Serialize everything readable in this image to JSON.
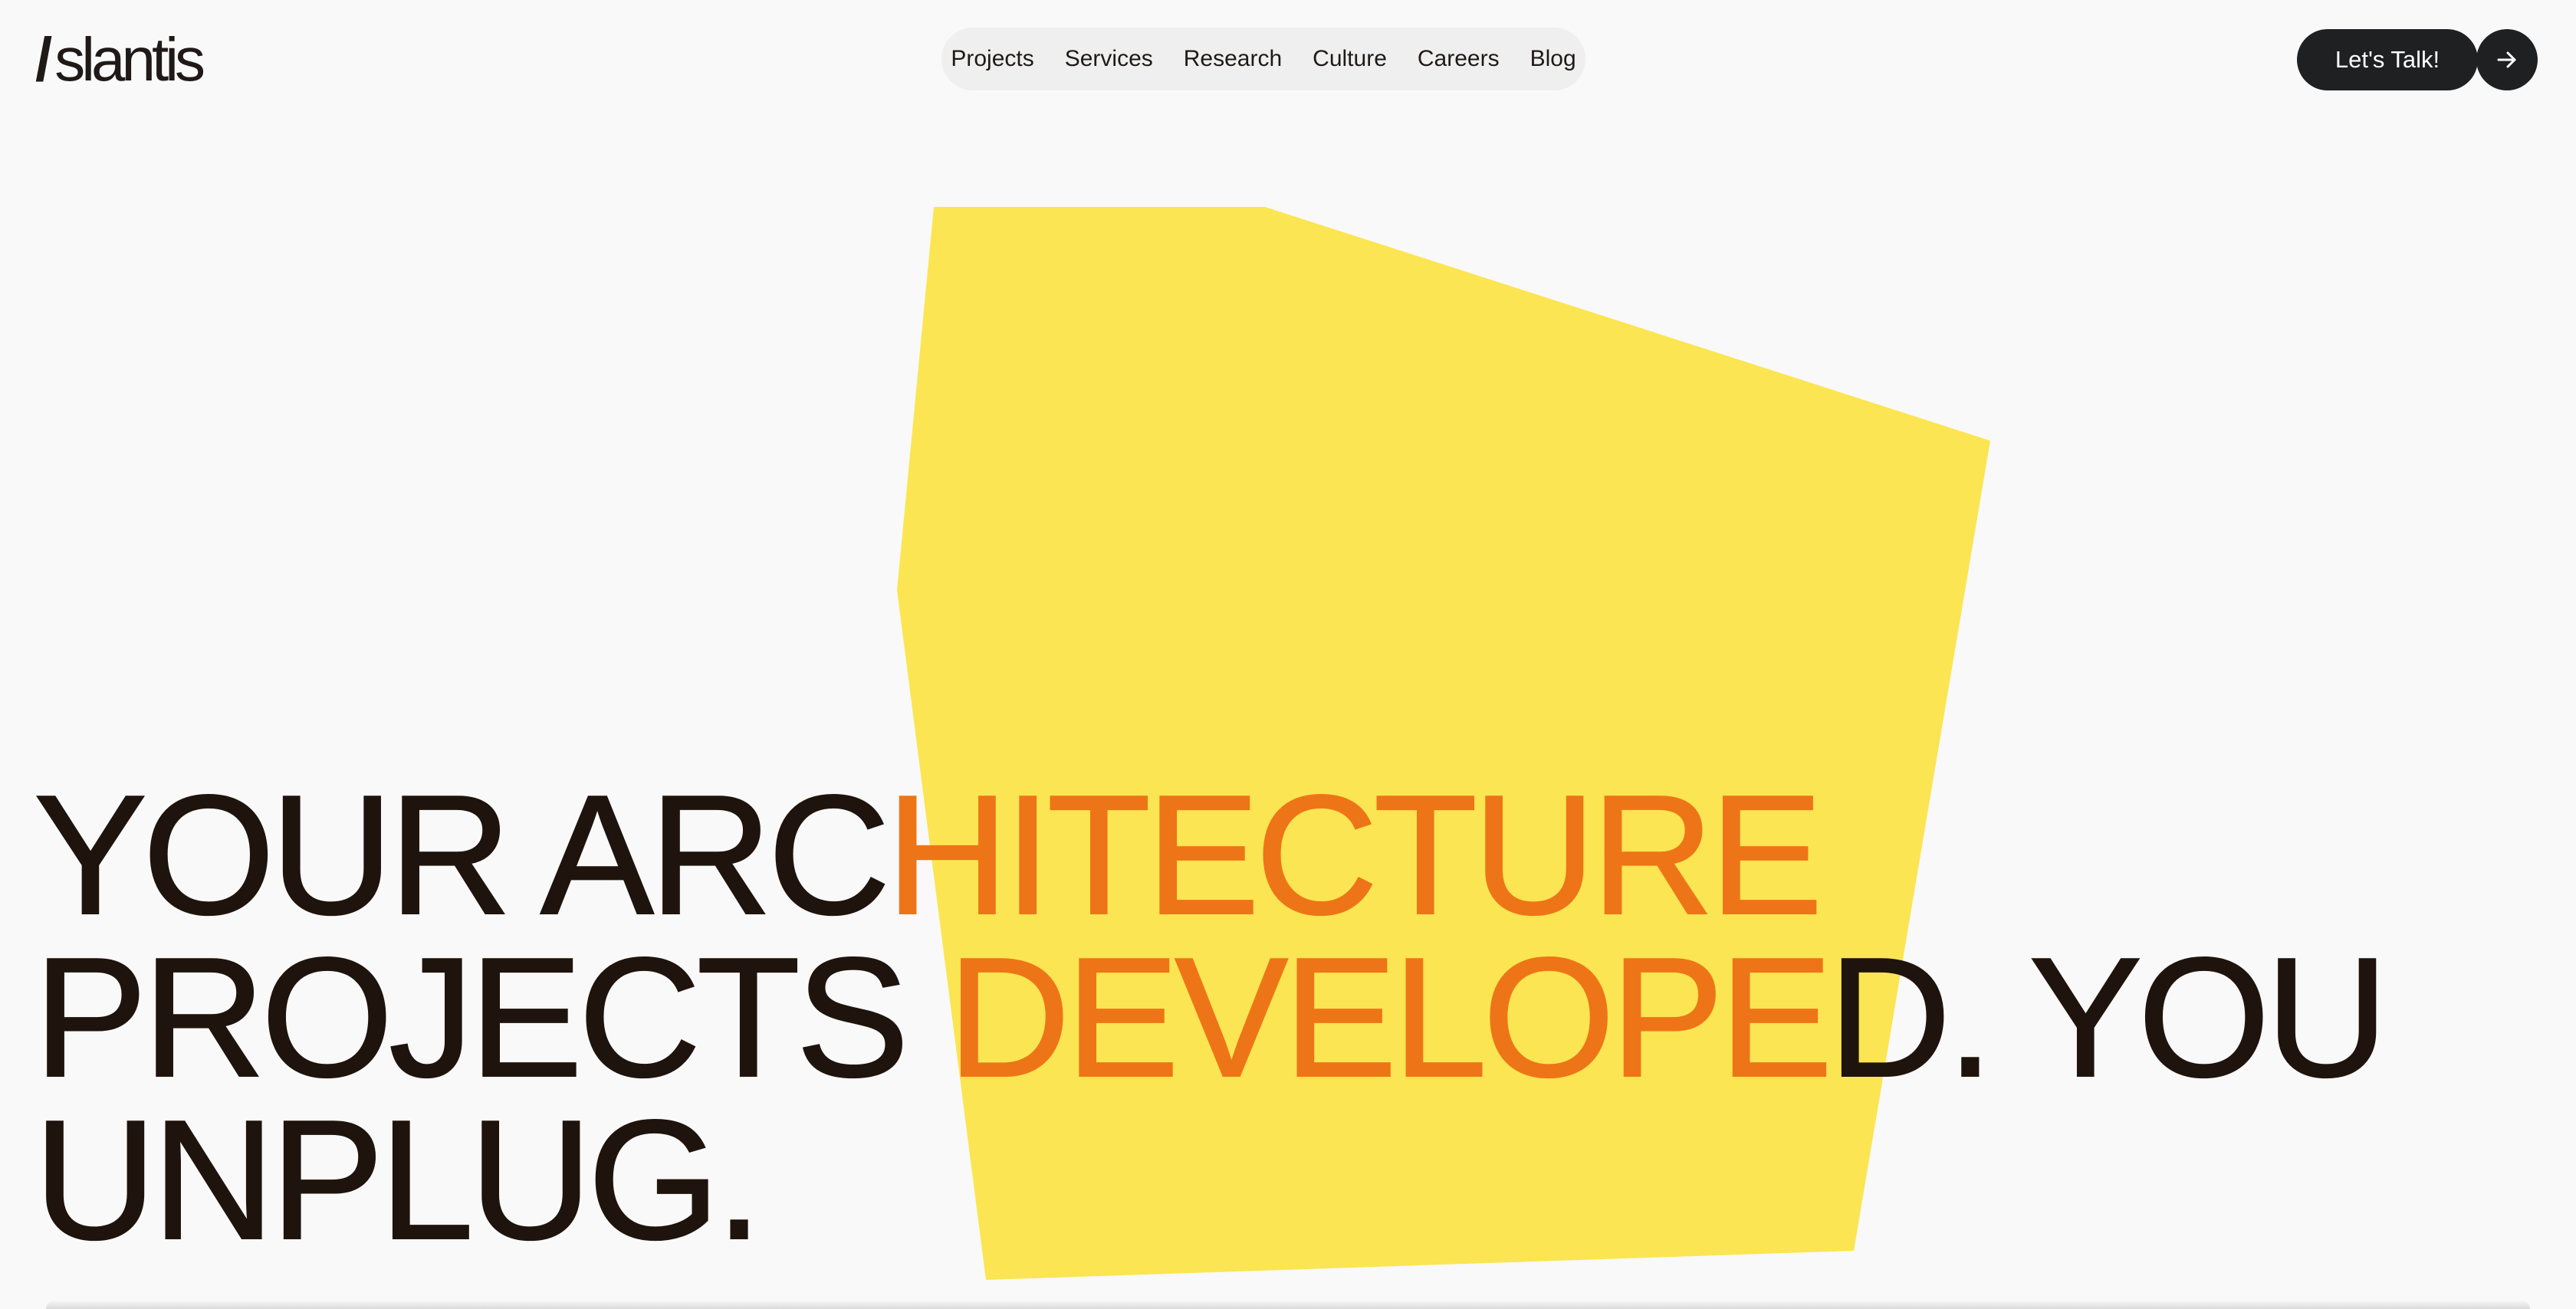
{
  "brand": {
    "slash": "/",
    "name": "slantis"
  },
  "nav": {
    "items": [
      {
        "label": "Projects"
      },
      {
        "label": "Services"
      },
      {
        "label": "Research"
      },
      {
        "label": "Culture"
      },
      {
        "label": "Careers"
      },
      {
        "label": "Blog"
      }
    ]
  },
  "cta": {
    "label": "Let's Talk!",
    "icon": "arrow-right-icon"
  },
  "hero": {
    "line1_dark": "YOUR ARC",
    "line1_orange": "HITECTURE",
    "line2_dark": "PROJECTS ",
    "line2_orange": "DEVELOPE",
    "line2_tail": "D. YOU",
    "line3": "UNPLUG."
  },
  "colors": {
    "background": "#f9f9f9",
    "accent_yellow": "#fbe552",
    "accent_orange": "#ee7517",
    "text_dark": "#1f140d",
    "button_dark": "#1f2022"
  }
}
